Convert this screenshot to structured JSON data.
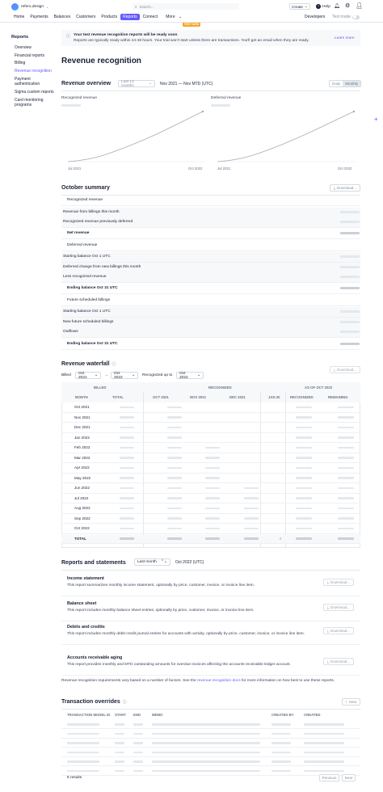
{
  "app": {
    "account": "refero.design",
    "search_placeholder": "Search...",
    "create": "Create",
    "help": "Help",
    "test_banner": "TEST DATA",
    "developers": "Developers",
    "test_mode": "Test mode"
  },
  "nav": [
    "Home",
    "Payments",
    "Balances",
    "Customers",
    "Products",
    "Reports",
    "Connect",
    "More"
  ],
  "sidebar": {
    "title": "Reports",
    "items": [
      "Overview",
      "Financial reports",
      "Billing",
      "Revenue recognition",
      "Payment authentication",
      "Sigma custom reports",
      "Card monitoring programs"
    ]
  },
  "notice": {
    "title": "Your test revenue recognition reports will be ready soon",
    "body": "Reports are typically ready within 24-48 hours. Your trial won't start unless there are transactions. You'll get an email when they are ready.",
    "link": "Learn more"
  },
  "page_title": "Revenue recognition",
  "overview": {
    "title": "Revenue overview",
    "range": "Last 12 months",
    "period": "Nov 2021 — Nov MTD (UTC)",
    "daily": "Daily",
    "monthly": "Monthly",
    "chart1": "Recognized revenue",
    "chart2": "Deferred revenue",
    "x_start": "Jul 2021",
    "x_end": "Oct 2022"
  },
  "october": {
    "title": "October summary",
    "download": "Download...",
    "rows": [
      {
        "label": "Recognized revenue",
        "kind": "section"
      },
      {
        "label": "Revenue from billings this month",
        "kind": "item"
      },
      {
        "label": "Recognized revenue previously deferred",
        "kind": "item"
      },
      {
        "label": "Net revenue",
        "kind": "total"
      },
      {
        "label": "Deferred revenue",
        "kind": "section"
      },
      {
        "label": "Starting balance Oct 1 UTC",
        "kind": "item"
      },
      {
        "label": "Deferred change from new billings this month",
        "kind": "item"
      },
      {
        "label": "Less recognized revenue",
        "kind": "item"
      },
      {
        "label": "Ending balance Oct 31 UTC",
        "kind": "total"
      },
      {
        "label": "Future scheduled billings",
        "kind": "section"
      },
      {
        "label": "Starting balance Oct 1 UTC",
        "kind": "item"
      },
      {
        "label": "New future scheduled billings",
        "kind": "item"
      },
      {
        "label": "Outflows",
        "kind": "item"
      },
      {
        "label": "Ending balance Oct 31 UTC",
        "kind": "total"
      }
    ]
  },
  "waterfall": {
    "title": "Revenue waterfall",
    "download": "Download...",
    "billed": "Billed",
    "from": "Oct 2021",
    "to": "Oct 2022",
    "recognized_up_to": "Recognized up to",
    "recognized_value": "Oct 2022",
    "group_billed": "BILLED",
    "group_recognized": "RECOGNIZED",
    "group_asof": "AS OF OCT 2022",
    "cols": [
      "MONTH",
      "TOTAL",
      "OCT 2021",
      "NOV 2021",
      "DEC 2021",
      "JAN 20",
      "RECOGNIZED",
      "REMAINING"
    ],
    "months": [
      "Oct 2021",
      "Nov 2021",
      "Dec 2021",
      "Jan 2022",
      "Feb 2022",
      "Mar 2022",
      "Apr 2022",
      "May 2022",
      "Jun 2022",
      "Jul 2022",
      "Aug 2022",
      "Sep 2022",
      "Oct 2022",
      "TOTAL"
    ]
  },
  "statements": {
    "title": "Reports and statements",
    "period_select": "Last month",
    "period": "Oct 2022 (UTC)",
    "download": "Download...",
    "items": [
      {
        "title": "Income statement",
        "desc": "This report summarizes monthly income statement, optionally by price, customer, invoice, or invoice line item."
      },
      {
        "title": "Balance sheet",
        "desc": "This report includes monthly balance sheet entries, optionally by price, customer, invoice, or invoice line item."
      },
      {
        "title": "Debits and credits",
        "desc": "This report includes monthly debit-credit journal entries for accounts with activity, optionally by price, customer, invoice, or invoice line item."
      },
      {
        "title": "Accounts receivable aging",
        "desc": "This report provides monthly and MTD outstanding amounts for overdue invoices affecting the accounts receivable ledger account."
      }
    ],
    "footer_pre": "Revenue recognition requirements vary based on a number of factors. See the ",
    "footer_link": "revenue recognition docs",
    "footer_post": " for more information on how best to use these reports."
  },
  "overrides": {
    "title": "Transaction overrides",
    "new": "New",
    "cols": [
      "TRANSACTION MODEL ID",
      "START",
      "END",
      "MEMO",
      "CREATED BY",
      "CREATED"
    ],
    "count": "6 results",
    "previous": "Previous",
    "next": "Next"
  }
}
